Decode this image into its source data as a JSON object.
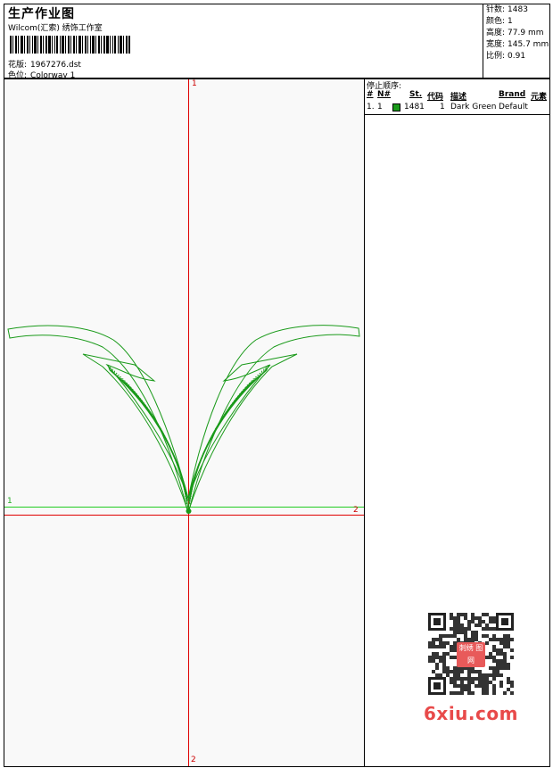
{
  "header": {
    "title": "生产作业图",
    "company": "Wilcom(汇索) 绣饰工作室",
    "design_label": "花版:",
    "design_value": "1967276.dst",
    "colorway_label": "色位:",
    "colorway_value": "Colorway 1"
  },
  "stats": [
    {
      "label": "针数:",
      "value": "1483"
    },
    {
      "label": "颜色:",
      "value": "1"
    },
    {
      "label": "高度:",
      "value": "77.9 mm"
    },
    {
      "label": "宽度:",
      "value": "145.7 mm"
    },
    {
      "label": "比例:",
      "value": "0.91"
    }
  ],
  "axes": {
    "top": "1",
    "bottom": "2",
    "left": "1",
    "right": "2"
  },
  "stop_sequence": {
    "heading": "停止顺序:",
    "columns": {
      "num": "#",
      "no": "N#",
      "st": "St.",
      "code": "代码",
      "desc": "描述",
      "brand": "Brand",
      "element": "元素"
    },
    "rows": [
      {
        "num": "1.",
        "no": "1",
        "color": "#1a9a1a",
        "st": "1481",
        "code": "1",
        "desc": "Dark Green",
        "brand": "Default",
        "element": ""
      }
    ]
  },
  "watermark": {
    "text": "6xiu.com",
    "qr_logo": "刺绣 图网"
  },
  "colors": {
    "axis": "#e00000",
    "baseline": "#22cc22",
    "stitch": "#1a9a1a"
  }
}
